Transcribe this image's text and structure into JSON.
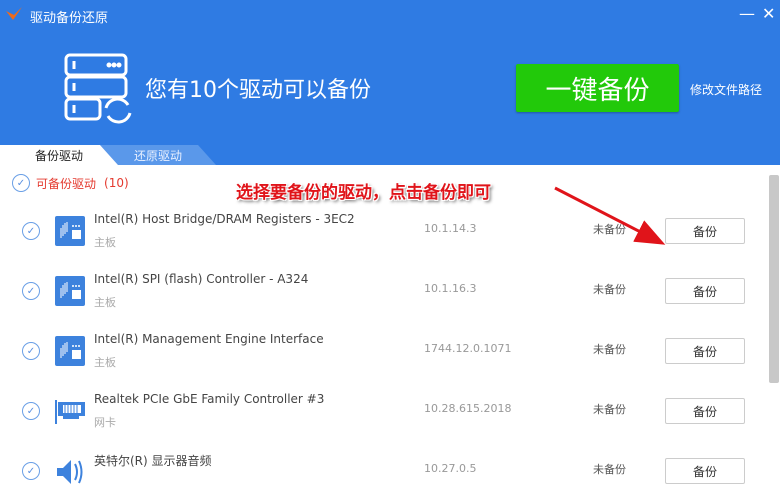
{
  "window": {
    "title": "驱动备份还原",
    "minimize": "—",
    "close": "✕"
  },
  "header": {
    "message": "您有10个驱动可以备份",
    "one_click_backup": "一键备份",
    "change_path": "修改文件路径"
  },
  "tabs": [
    {
      "label": "备份驱动",
      "active": true
    },
    {
      "label": "还原驱动",
      "active": false
    }
  ],
  "section": {
    "label": "可备份驱动",
    "count": "(10)"
  },
  "annotation": "选择要备份的驱动，点击备份即可",
  "drivers": [
    {
      "name": "Intel(R) Host Bridge/DRAM Registers - 3EC2",
      "category": "主板",
      "version": "10.1.14.3",
      "status": "未备份",
      "action": "备份",
      "icon": "motherboard-icon"
    },
    {
      "name": "Intel(R) SPI (flash) Controller - A324",
      "category": "主板",
      "version": "10.1.16.3",
      "status": "未备份",
      "action": "备份",
      "icon": "motherboard-icon"
    },
    {
      "name": "Intel(R) Management Engine Interface",
      "category": "主板",
      "version": "1744.12.0.1071",
      "status": "未备份",
      "action": "备份",
      "icon": "motherboard-icon"
    },
    {
      "name": "Realtek PCIe GbE Family Controller #3",
      "category": "网卡",
      "version": "10.28.615.2018",
      "status": "未备份",
      "action": "备份",
      "icon": "network-card-icon"
    },
    {
      "name": "英特尔(R) 显示器音频",
      "category": "",
      "version": "10.27.0.5",
      "status": "未备份",
      "action": "备份",
      "icon": "speaker-icon"
    }
  ]
}
